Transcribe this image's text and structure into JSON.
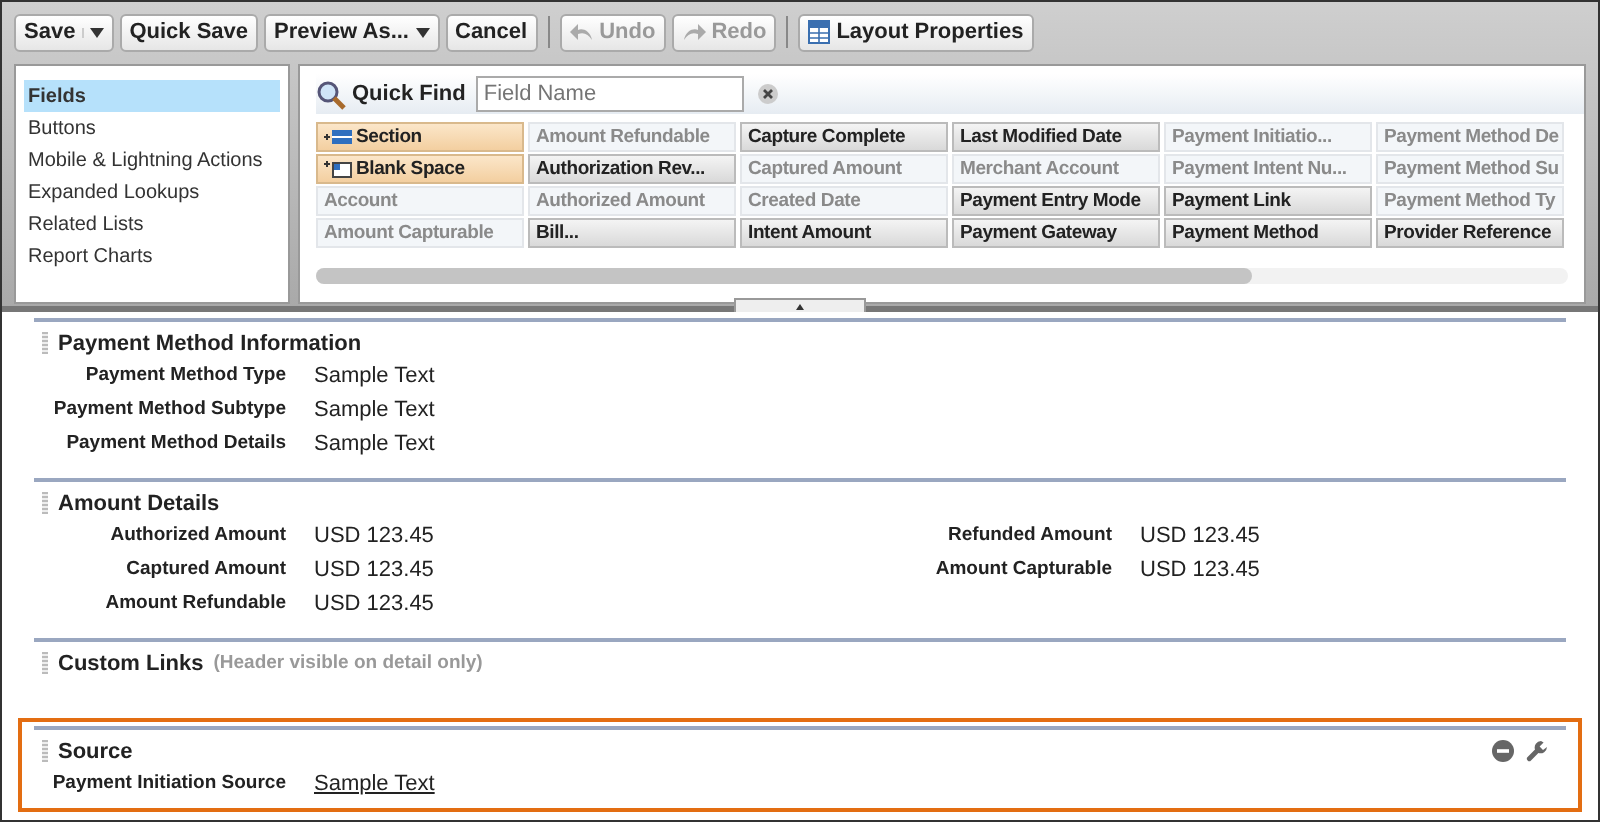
{
  "toolbar": [
    {
      "kind": "split",
      "label": "Save",
      "disabled": false
    },
    {
      "kind": "plain",
      "label": "Quick Save",
      "disabled": false
    },
    {
      "kind": "menu",
      "label": "Preview As...",
      "disabled": false
    },
    {
      "kind": "plain",
      "label": "Cancel",
      "disabled": false
    },
    {
      "kind": "separator"
    },
    {
      "kind": "undo",
      "label": "Undo",
      "disabled": true
    },
    {
      "kind": "redo",
      "label": "Redo",
      "disabled": true
    },
    {
      "kind": "separator"
    },
    {
      "kind": "properties",
      "label": "Layout Properties",
      "disabled": false
    }
  ],
  "sidebar": {
    "items": [
      {
        "label": "Fields",
        "selected": true
      },
      {
        "label": "Buttons",
        "selected": false
      },
      {
        "label": "Mobile & Lightning Actions",
        "selected": false
      },
      {
        "label": "Expanded Lookups",
        "selected": false
      },
      {
        "label": "Related Lists",
        "selected": false
      },
      {
        "label": "Report Charts",
        "selected": false
      }
    ]
  },
  "quick_find": {
    "label": "Quick Find",
    "placeholder": "Field Name"
  },
  "palette_fields": [
    {
      "label": "Section",
      "kind": "section"
    },
    {
      "label": "Amount Refundable",
      "kind": "field",
      "used": true
    },
    {
      "label": "Capture Complete",
      "kind": "field",
      "used": false
    },
    {
      "label": "Last Modified Date",
      "kind": "field",
      "used": false
    },
    {
      "label": "Payment Initiatio...",
      "kind": "field",
      "used": true
    },
    {
      "label": "Payment Method De",
      "kind": "field",
      "used": true
    },
    {
      "label": "Blank Space",
      "kind": "blank"
    },
    {
      "label": "Authorization Rev...",
      "kind": "field",
      "used": false
    },
    {
      "label": "Captured Amount",
      "kind": "field",
      "used": true
    },
    {
      "label": "Merchant Account",
      "kind": "field",
      "used": true
    },
    {
      "label": "Payment Intent Nu...",
      "kind": "field",
      "used": true
    },
    {
      "label": "Payment Method Su",
      "kind": "field",
      "used": true
    },
    {
      "label": "Account",
      "kind": "field",
      "used": true
    },
    {
      "label": "Authorized Amount",
      "kind": "field",
      "used": true
    },
    {
      "label": "Created Date",
      "kind": "field",
      "used": true
    },
    {
      "label": "Payment Entry Mode",
      "kind": "field",
      "used": false
    },
    {
      "label": "Payment Link",
      "kind": "field",
      "used": false
    },
    {
      "label": "Payment Method Ty",
      "kind": "field",
      "used": true
    },
    {
      "label": "Amount Capturable",
      "kind": "field",
      "used": true
    },
    {
      "label": "Bill...",
      "kind": "field",
      "used": false
    },
    {
      "label": "Intent Amount",
      "kind": "field",
      "used": false
    },
    {
      "label": "Payment Gateway",
      "kind": "field",
      "used": false
    },
    {
      "label": "Payment Method",
      "kind": "field",
      "used": false
    },
    {
      "label": "Provider Reference",
      "kind": "field",
      "used": false
    }
  ],
  "sections": [
    {
      "title": "Payment Method Information",
      "rows": [
        [
          {
            "label": "Payment Method Type",
            "value": "Sample Text"
          }
        ],
        [
          {
            "label": "Payment Method Subtype",
            "value": "Sample Text"
          }
        ],
        [
          {
            "label": "Payment Method Details",
            "value": "Sample Text"
          }
        ]
      ]
    },
    {
      "title": "Amount Details",
      "rows": [
        [
          {
            "label": "Authorized Amount",
            "value": "USD 123.45"
          },
          {
            "label": "Refunded Amount",
            "value": "USD 123.45"
          }
        ],
        [
          {
            "label": "Captured Amount",
            "value": "USD 123.45"
          },
          {
            "label": "Amount Capturable",
            "value": "USD 123.45"
          }
        ],
        [
          {
            "label": "Amount Refundable",
            "value": "USD 123.45"
          }
        ]
      ]
    },
    {
      "title": "Custom Links",
      "note": "(Header visible on detail only)"
    },
    {
      "title": "Source",
      "highlighted": true,
      "rows": [
        [
          {
            "label": "Payment Initiation Source",
            "value": "Sample Text",
            "underlined": true
          }
        ]
      ]
    }
  ]
}
